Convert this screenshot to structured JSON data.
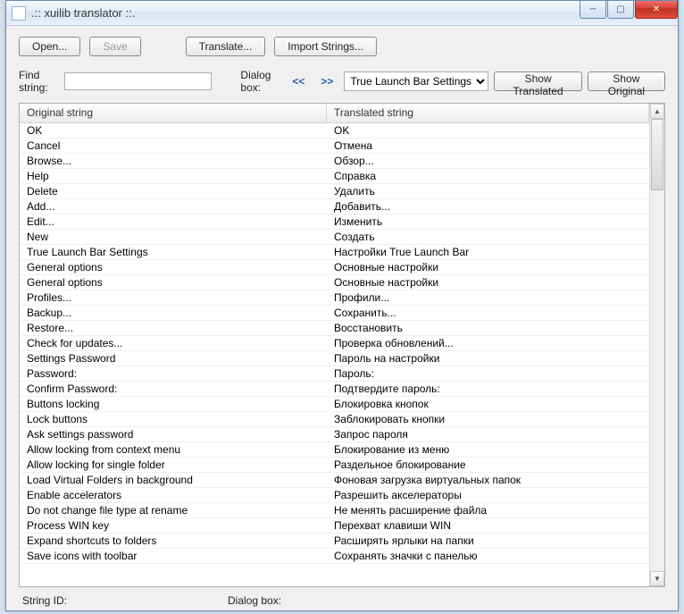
{
  "window": {
    "title": ".:: xuilib translator ::."
  },
  "toolbar": {
    "open": "Open...",
    "save": "Save",
    "translate": "Translate...",
    "import": "Import Strings..."
  },
  "controls": {
    "find_label": "Find string:",
    "find_value": "",
    "dialog_label": "Dialog box:",
    "nav_prev": "<<",
    "nav_next": ">>",
    "combo_selected": "True Launch Bar Settings",
    "show_translated": "Show Translated",
    "show_original": "Show Original"
  },
  "columns": {
    "original": "Original string",
    "translated": "Translated string"
  },
  "rows": [
    {
      "o": "OK",
      "t": "OK"
    },
    {
      "o": "Cancel",
      "t": "Отмена"
    },
    {
      "o": "Browse...",
      "t": "Обзор..."
    },
    {
      "o": "Help",
      "t": "Справка"
    },
    {
      "o": "Delete",
      "t": "Удалить"
    },
    {
      "o": "Add...",
      "t": "Добавить..."
    },
    {
      "o": "Edit...",
      "t": "Изменить"
    },
    {
      "o": "New",
      "t": "Создать"
    },
    {
      "o": "True Launch Bar Settings",
      "t": "Настройки True Launch Bar"
    },
    {
      "o": "General options",
      "t": "Основные настройки"
    },
    {
      "o": "General options",
      "t": "Основные настройки"
    },
    {
      "o": "Profiles...",
      "t": "Профили..."
    },
    {
      "o": "Backup...",
      "t": "Сохранить..."
    },
    {
      "o": "Restore...",
      "t": "Восстановить"
    },
    {
      "o": "Check for updates...",
      "t": "Проверка обновлений..."
    },
    {
      "o": "Settings Password",
      "t": "Пароль на настройки"
    },
    {
      "o": "Password:",
      "t": "Пароль:"
    },
    {
      "o": "Confirm Password:",
      "t": "Подтвердите пароль:"
    },
    {
      "o": "Buttons locking",
      "t": "Блокировка кнопок"
    },
    {
      "o": "Lock buttons",
      "t": "Заблокировать кнопки"
    },
    {
      "o": "Ask settings password",
      "t": "Запрос пароля"
    },
    {
      "o": "Allow locking from context menu",
      "t": "Блокирование из меню"
    },
    {
      "o": "Allow locking for single folder",
      "t": "Раздельное блокирование"
    },
    {
      "o": "Load Virtual Folders in background",
      "t": "Фоновая загрузка виртуальных папок"
    },
    {
      "o": "Enable accelerators",
      "t": "Разрешить акселераторы"
    },
    {
      "o": "Do not change file type at rename",
      "t": "Не менять расширение файла"
    },
    {
      "o": "Process WIN key",
      "t": "Перехват клавиши WIN"
    },
    {
      "o": "Expand shortcuts to folders",
      "t": "Расширять ярлыки на папки"
    },
    {
      "o": "Save icons with toolbar",
      "t": "Сохранять значки с панелью"
    }
  ],
  "status": {
    "string_id_label": "String ID:",
    "string_id_value": "",
    "dialog_box_label": "Dialog box:",
    "dialog_box_value": ""
  }
}
